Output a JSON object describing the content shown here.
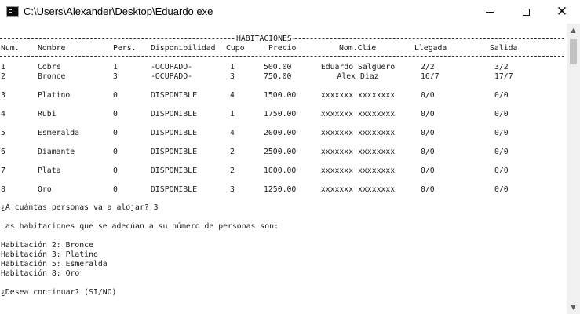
{
  "window": {
    "title": "C:\\Users\\Alexander\\Desktop\\Eduardo.exe",
    "minimize_icon": "minimize-icon",
    "maximize_icon": "maximize-icon",
    "close_glyph": "✕"
  },
  "table": {
    "title": "HABITACIONES",
    "headers": [
      "Num.",
      "Nombre",
      "Pers.",
      "Disponibilidad",
      "Cupo",
      "Precio",
      "Nom.Clie",
      "Llegada",
      "Salida"
    ],
    "rows": [
      [
        "1",
        "Cobre",
        "1",
        "-OCUPADO-",
        "1",
        "500.00",
        "Eduardo Salguero",
        "2/2",
        "3/2"
      ],
      [
        "2",
        "Bronce",
        "3",
        "-OCUPADO-",
        "3",
        "750.00",
        "Alex Diaz",
        "16/7",
        "17/7"
      ],
      [
        "3",
        "Platino",
        "0",
        "DISPONIBLE",
        "4",
        "1500.00",
        "xxxxxxx xxxxxxxx",
        "0/0",
        "0/0"
      ],
      [
        "4",
        "Rubi",
        "0",
        "DISPONIBLE",
        "1",
        "1750.00",
        "xxxxxxx xxxxxxxx",
        "0/0",
        "0/0"
      ],
      [
        "5",
        "Esmeralda",
        "0",
        "DISPONIBLE",
        "4",
        "2000.00",
        "xxxxxxx xxxxxxxx",
        "0/0",
        "0/0"
      ],
      [
        "6",
        "Diamante",
        "0",
        "DISPONIBLE",
        "2",
        "2500.00",
        "xxxxxxx xxxxxxxx",
        "0/0",
        "0/0"
      ],
      [
        "7",
        "Plata",
        "0",
        "DISPONIBLE",
        "2",
        "1000.00",
        "xxxxxxx xxxxxxxx",
        "0/0",
        "0/0"
      ],
      [
        "8",
        "Oro",
        "0",
        "DISPONIBLE",
        "3",
        "1250.00",
        "xxxxxxx xxxxxxxx",
        "0/0",
        "0/0"
      ]
    ]
  },
  "prompt_question": "¿A cuántas personas va a alojar? 3",
  "result_intro": "Las habitaciones que se adecúan a su número de personas son:",
  "matches": [
    "Habitación 2: Bronce",
    "Habitación 3: Platino",
    "Habitación 5: Esmeralda",
    "Habitación 8: Oro"
  ],
  "continue_prompt": "¿Desea continuar? (SI/NO)",
  "scrollbar": {
    "up_glyph": "▲",
    "down_glyph": "▼"
  }
}
